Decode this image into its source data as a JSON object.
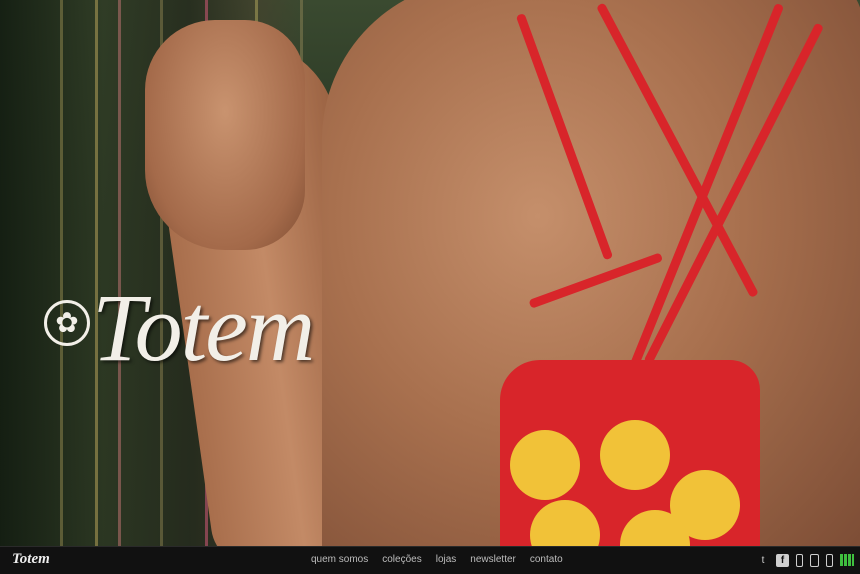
{
  "brand": {
    "logo_text": "Totem",
    "footer_logo_text": "Totem"
  },
  "nav": {
    "items": [
      {
        "label": "quem somos"
      },
      {
        "label": "coleções"
      },
      {
        "label": "lojas"
      },
      {
        "label": "newsletter"
      },
      {
        "label": "contato"
      }
    ]
  },
  "social": {
    "icons": [
      {
        "name": "twitter-icon",
        "glyph": "t"
      },
      {
        "name": "facebook-icon",
        "glyph": "f"
      },
      {
        "name": "mobile-icon",
        "glyph": ""
      },
      {
        "name": "tablet-icon",
        "glyph": ""
      },
      {
        "name": "phone-icon",
        "glyph": ""
      },
      {
        "name": "grid-icon",
        "glyph": ""
      }
    ]
  },
  "colors": {
    "bar_bg": "#111111",
    "nav_text": "#bdbdbd",
    "accent_green": "#3fbf3f",
    "dress_red": "#d8252a",
    "dress_yellow": "#f1c238"
  }
}
